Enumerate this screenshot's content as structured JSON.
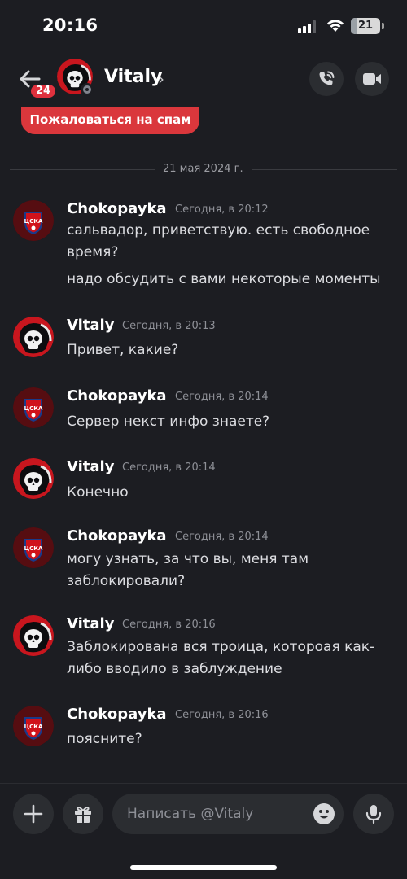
{
  "status_bar": {
    "time": "20:16",
    "battery_level": "21",
    "signal_bars_filled": 3,
    "signal_bars_total": 4
  },
  "header": {
    "back_badge": "24",
    "contact_name": "Vitaly",
    "chevron": "›",
    "icons": [
      "back-arrow-icon",
      "phone-call-icon",
      "video-camera-icon"
    ]
  },
  "spam_button": {
    "label": "Пожаловаться на спам"
  },
  "date_divider": {
    "label": "21 мая 2024 г."
  },
  "messages": [
    {
      "author": "Chokopayka",
      "time": "Сегодня, в 20:12",
      "lines": [
        "сальвадор, приветствую. есть свободное",
        "время?",
        "надо обсудить с вами некоторые моменты"
      ],
      "avatar": "cska-logo"
    },
    {
      "author": "Vitaly",
      "time": "Сегодня, в 20:13",
      "lines": [
        "Привет, какие?"
      ],
      "avatar": "skull-reaper"
    },
    {
      "author": "Chokopayka",
      "time": "Сегодня, в 20:14",
      "lines": [
        "Сервер некст инфо знаете?"
      ],
      "avatar": "cska-logo"
    },
    {
      "author": "Vitaly",
      "time": "Сегодня, в 20:14",
      "lines": [
        "Конечно"
      ],
      "avatar": "skull-reaper"
    },
    {
      "author": "Chokopayka",
      "time": "Сегодня, в 20:14",
      "lines": [
        "могу узнать, за что вы, меня там",
        "заблокировали?"
      ],
      "avatar": "cska-logo"
    },
    {
      "author": "Vitaly",
      "time": "Сегодня, в 20:16",
      "lines": [
        "Заблокирована вся троица, котороая как-",
        "либо вводило в заблуждение"
      ],
      "avatar": "skull-reaper"
    },
    {
      "author": "Chokopayka",
      "time": "Сегодня, в 20:16",
      "lines": [
        "поясните?"
      ],
      "avatar": "cska-logo"
    }
  ],
  "composer": {
    "placeholder": "Написать @Vitaly",
    "icons": [
      "plus-icon",
      "gift-icon",
      "emoji-icon",
      "microphone-icon"
    ]
  },
  "colors": {
    "background": "#1c1d22",
    "surface": "#2b2d31",
    "danger": "#da373c",
    "badge": "#e0313e",
    "text_muted": "#8e9097"
  }
}
